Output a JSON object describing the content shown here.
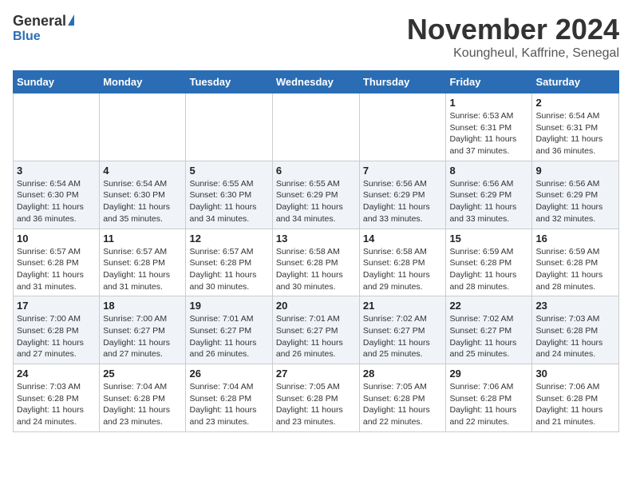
{
  "header": {
    "logo_general": "General",
    "logo_blue": "Blue",
    "title": "November 2024",
    "location": "Koungheul, Kaffrine, Senegal"
  },
  "calendar": {
    "days_of_week": [
      "Sunday",
      "Monday",
      "Tuesday",
      "Wednesday",
      "Thursday",
      "Friday",
      "Saturday"
    ],
    "weeks": [
      [
        {
          "day": "",
          "info": ""
        },
        {
          "day": "",
          "info": ""
        },
        {
          "day": "",
          "info": ""
        },
        {
          "day": "",
          "info": ""
        },
        {
          "day": "",
          "info": ""
        },
        {
          "day": "1",
          "info": "Sunrise: 6:53 AM\nSunset: 6:31 PM\nDaylight: 11 hours\nand 37 minutes."
        },
        {
          "day": "2",
          "info": "Sunrise: 6:54 AM\nSunset: 6:31 PM\nDaylight: 11 hours\nand 36 minutes."
        }
      ],
      [
        {
          "day": "3",
          "info": "Sunrise: 6:54 AM\nSunset: 6:30 PM\nDaylight: 11 hours\nand 36 minutes."
        },
        {
          "day": "4",
          "info": "Sunrise: 6:54 AM\nSunset: 6:30 PM\nDaylight: 11 hours\nand 35 minutes."
        },
        {
          "day": "5",
          "info": "Sunrise: 6:55 AM\nSunset: 6:30 PM\nDaylight: 11 hours\nand 34 minutes."
        },
        {
          "day": "6",
          "info": "Sunrise: 6:55 AM\nSunset: 6:29 PM\nDaylight: 11 hours\nand 34 minutes."
        },
        {
          "day": "7",
          "info": "Sunrise: 6:56 AM\nSunset: 6:29 PM\nDaylight: 11 hours\nand 33 minutes."
        },
        {
          "day": "8",
          "info": "Sunrise: 6:56 AM\nSunset: 6:29 PM\nDaylight: 11 hours\nand 33 minutes."
        },
        {
          "day": "9",
          "info": "Sunrise: 6:56 AM\nSunset: 6:29 PM\nDaylight: 11 hours\nand 32 minutes."
        }
      ],
      [
        {
          "day": "10",
          "info": "Sunrise: 6:57 AM\nSunset: 6:28 PM\nDaylight: 11 hours\nand 31 minutes."
        },
        {
          "day": "11",
          "info": "Sunrise: 6:57 AM\nSunset: 6:28 PM\nDaylight: 11 hours\nand 31 minutes."
        },
        {
          "day": "12",
          "info": "Sunrise: 6:57 AM\nSunset: 6:28 PM\nDaylight: 11 hours\nand 30 minutes."
        },
        {
          "day": "13",
          "info": "Sunrise: 6:58 AM\nSunset: 6:28 PM\nDaylight: 11 hours\nand 30 minutes."
        },
        {
          "day": "14",
          "info": "Sunrise: 6:58 AM\nSunset: 6:28 PM\nDaylight: 11 hours\nand 29 minutes."
        },
        {
          "day": "15",
          "info": "Sunrise: 6:59 AM\nSunset: 6:28 PM\nDaylight: 11 hours\nand 28 minutes."
        },
        {
          "day": "16",
          "info": "Sunrise: 6:59 AM\nSunset: 6:28 PM\nDaylight: 11 hours\nand 28 minutes."
        }
      ],
      [
        {
          "day": "17",
          "info": "Sunrise: 7:00 AM\nSunset: 6:28 PM\nDaylight: 11 hours\nand 27 minutes."
        },
        {
          "day": "18",
          "info": "Sunrise: 7:00 AM\nSunset: 6:27 PM\nDaylight: 11 hours\nand 27 minutes."
        },
        {
          "day": "19",
          "info": "Sunrise: 7:01 AM\nSunset: 6:27 PM\nDaylight: 11 hours\nand 26 minutes."
        },
        {
          "day": "20",
          "info": "Sunrise: 7:01 AM\nSunset: 6:27 PM\nDaylight: 11 hours\nand 26 minutes."
        },
        {
          "day": "21",
          "info": "Sunrise: 7:02 AM\nSunset: 6:27 PM\nDaylight: 11 hours\nand 25 minutes."
        },
        {
          "day": "22",
          "info": "Sunrise: 7:02 AM\nSunset: 6:27 PM\nDaylight: 11 hours\nand 25 minutes."
        },
        {
          "day": "23",
          "info": "Sunrise: 7:03 AM\nSunset: 6:28 PM\nDaylight: 11 hours\nand 24 minutes."
        }
      ],
      [
        {
          "day": "24",
          "info": "Sunrise: 7:03 AM\nSunset: 6:28 PM\nDaylight: 11 hours\nand 24 minutes."
        },
        {
          "day": "25",
          "info": "Sunrise: 7:04 AM\nSunset: 6:28 PM\nDaylight: 11 hours\nand 23 minutes."
        },
        {
          "day": "26",
          "info": "Sunrise: 7:04 AM\nSunset: 6:28 PM\nDaylight: 11 hours\nand 23 minutes."
        },
        {
          "day": "27",
          "info": "Sunrise: 7:05 AM\nSunset: 6:28 PM\nDaylight: 11 hours\nand 23 minutes."
        },
        {
          "day": "28",
          "info": "Sunrise: 7:05 AM\nSunset: 6:28 PM\nDaylight: 11 hours\nand 22 minutes."
        },
        {
          "day": "29",
          "info": "Sunrise: 7:06 AM\nSunset: 6:28 PM\nDaylight: 11 hours\nand 22 minutes."
        },
        {
          "day": "30",
          "info": "Sunrise: 7:06 AM\nSunset: 6:28 PM\nDaylight: 11 hours\nand 21 minutes."
        }
      ]
    ]
  }
}
